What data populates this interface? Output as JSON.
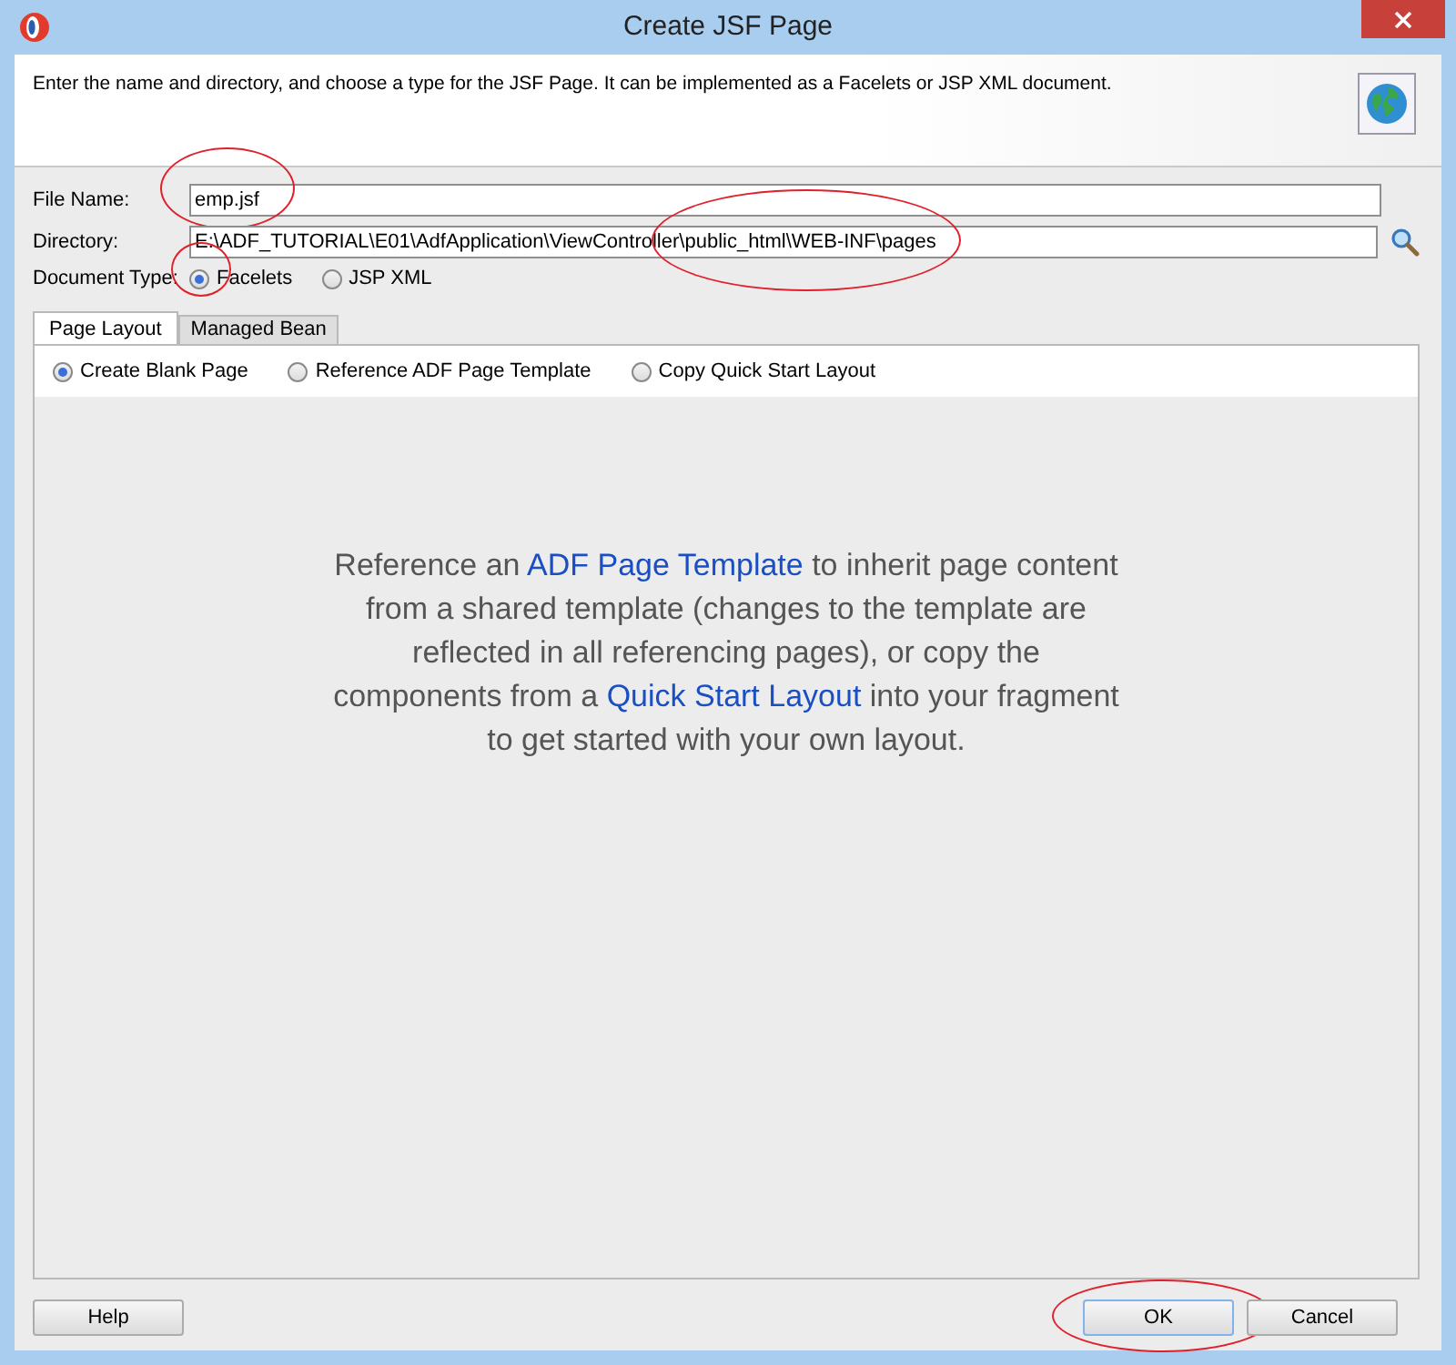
{
  "window": {
    "title": "Create JSF Page"
  },
  "header": {
    "description": "Enter the name and directory, and choose a type for the JSF Page. It can be implemented as a Facelets or JSP XML document."
  },
  "fields": [
    {
      "label": "File Name:",
      "value": "emp.jsf",
      "circled": true
    },
    {
      "label": "Directory:",
      "value": "E:\\ADF_TUTORIAL\\E01\\AdfApplication\\ViewController\\public_html\\WEB-INF\\pages",
      "circled": true
    }
  ],
  "document_type": {
    "label": "Document Type:",
    "options": [
      {
        "label": "Facelets",
        "selected": true,
        "circled": true
      },
      {
        "label": "JSP XML",
        "selected": false,
        "circled": false
      }
    ]
  },
  "tabs": [
    {
      "label": "Page Layout",
      "selected": true
    },
    {
      "label": "Managed Bean",
      "selected": false
    }
  ],
  "layout_options": [
    {
      "label": "Create Blank Page",
      "selected": true
    },
    {
      "label": "Reference ADF Page Template",
      "selected": false
    },
    {
      "label": "Copy Quick Start Layout",
      "selected": false
    }
  ],
  "info": [
    {
      "kind": "text",
      "text": "Reference an "
    },
    {
      "kind": "link",
      "text": "ADF Page Template"
    },
    {
      "kind": "text",
      "text": " to inherit page content from a shared template (changes to the template are reflected in all referencing pages), or copy the components from a "
    },
    {
      "kind": "link",
      "text": "Quick Start Layout"
    },
    {
      "kind": "text",
      "text": " into your fragment to get started with your own layout."
    }
  ],
  "buttons": [
    {
      "label": "Help",
      "kind": "left",
      "circled": false
    },
    {
      "label": "OK",
      "kind": "right",
      "circled": true
    },
    {
      "label": "Cancel",
      "kind": "right",
      "circled": false
    }
  ]
}
